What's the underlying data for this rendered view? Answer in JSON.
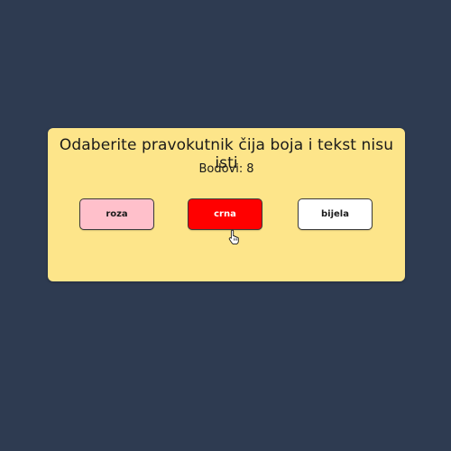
{
  "game": {
    "title": "Odaberite pravokutnik čija boja i tekst nisu isti",
    "score_label": "Bodovi:",
    "score_value": "8"
  },
  "buttons": [
    {
      "label": "roza",
      "color": "#ffc0cb"
    },
    {
      "label": "crna",
      "color": "#ff0000"
    },
    {
      "label": "bijela",
      "color": "#ffffff"
    }
  ],
  "colors": {
    "background": "#2e3b51",
    "card": "#fde58a"
  },
  "cursor": {
    "icon": "hand-pointer-icon"
  }
}
